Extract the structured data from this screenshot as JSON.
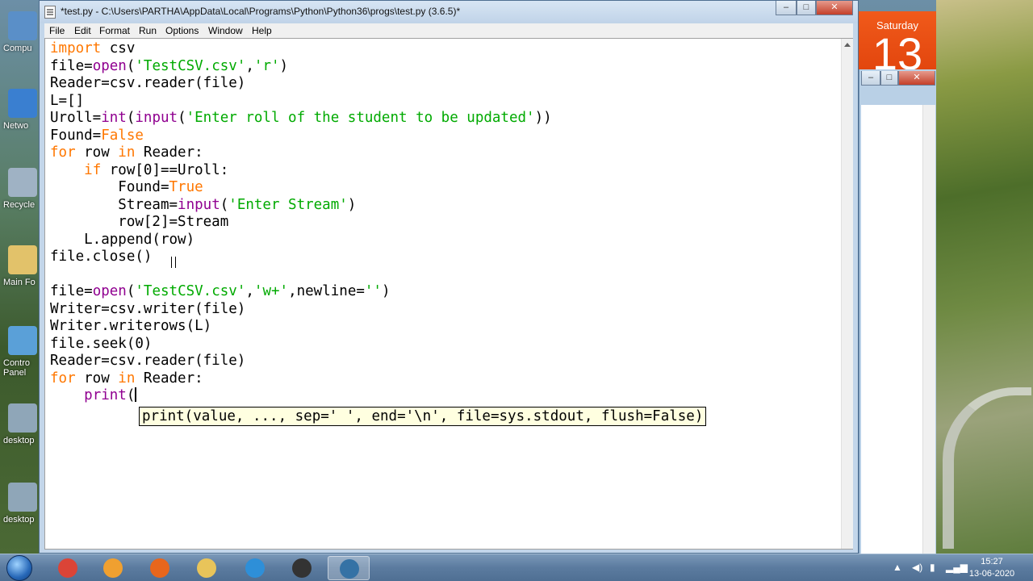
{
  "window": {
    "title": "*test.py - C:\\Users\\PARTHA\\AppData\\Local\\Programs\\Python\\Python36\\progs\\test.py (3.6.5)*",
    "controls": {
      "minimize": "–",
      "maximize": "□",
      "close": "✕"
    }
  },
  "menu": [
    "File",
    "Edit",
    "Format",
    "Run",
    "Options",
    "Window",
    "Help"
  ],
  "code_lines": [
    [
      {
        "t": "import",
        "c": "kw"
      },
      {
        "t": " csv",
        "c": ""
      }
    ],
    [
      {
        "t": "file=",
        "c": ""
      },
      {
        "t": "open",
        "c": "bi"
      },
      {
        "t": "(",
        "c": ""
      },
      {
        "t": "'TestCSV.csv'",
        "c": "str"
      },
      {
        "t": ",",
        "c": ""
      },
      {
        "t": "'r'",
        "c": "str"
      },
      {
        "t": ")",
        "c": ""
      }
    ],
    [
      {
        "t": "Reader=csv.reader(file)",
        "c": ""
      }
    ],
    [
      {
        "t": "L=[]",
        "c": ""
      }
    ],
    [
      {
        "t": "Uroll=",
        "c": ""
      },
      {
        "t": "int",
        "c": "bi"
      },
      {
        "t": "(",
        "c": ""
      },
      {
        "t": "input",
        "c": "bi"
      },
      {
        "t": "(",
        "c": ""
      },
      {
        "t": "'Enter roll of the student to be updated'",
        "c": "str"
      },
      {
        "t": "))",
        "c": ""
      }
    ],
    [
      {
        "t": "Found=",
        "c": ""
      },
      {
        "t": "False",
        "c": "kw"
      }
    ],
    [
      {
        "t": "for",
        "c": "kw"
      },
      {
        "t": " row ",
        "c": ""
      },
      {
        "t": "in",
        "c": "kw"
      },
      {
        "t": " Reader:",
        "c": ""
      }
    ],
    [
      {
        "t": "    ",
        "c": ""
      },
      {
        "t": "if",
        "c": "kw"
      },
      {
        "t": " row[0]==Uroll:",
        "c": ""
      }
    ],
    [
      {
        "t": "        Found=",
        "c": ""
      },
      {
        "t": "True",
        "c": "kw"
      }
    ],
    [
      {
        "t": "        Stream=",
        "c": ""
      },
      {
        "t": "input",
        "c": "bi"
      },
      {
        "t": "(",
        "c": ""
      },
      {
        "t": "'Enter Stream'",
        "c": "str"
      },
      {
        "t": ")",
        "c": ""
      }
    ],
    [
      {
        "t": "        row[2]=Stream",
        "c": ""
      }
    ],
    [
      {
        "t": "    L.append(row)",
        "c": ""
      }
    ],
    [
      {
        "t": "file.close()",
        "c": ""
      }
    ],
    [],
    [
      {
        "t": "file=",
        "c": ""
      },
      {
        "t": "open",
        "c": "bi"
      },
      {
        "t": "(",
        "c": ""
      },
      {
        "t": "'TestCSV.csv'",
        "c": "str"
      },
      {
        "t": ",",
        "c": ""
      },
      {
        "t": "'w+'",
        "c": "str"
      },
      {
        "t": ",newline=",
        "c": ""
      },
      {
        "t": "''",
        "c": "str"
      },
      {
        "t": ")",
        "c": ""
      }
    ],
    [
      {
        "t": "Writer=csv.writer(file)",
        "c": ""
      }
    ],
    [
      {
        "t": "Writer.writerows(L)",
        "c": ""
      }
    ],
    [
      {
        "t": "file.seek(0)",
        "c": ""
      }
    ],
    [
      {
        "t": "Reader=csv.reader(file)",
        "c": ""
      }
    ],
    [
      {
        "t": "for",
        "c": "kw"
      },
      {
        "t": " row ",
        "c": ""
      },
      {
        "t": "in",
        "c": "kw"
      },
      {
        "t": " Reader:",
        "c": ""
      }
    ],
    [
      {
        "t": "    ",
        "c": ""
      },
      {
        "t": "print",
        "c": "bi"
      },
      {
        "t": "(",
        "c": ""
      }
    ]
  ],
  "calltip": "print(value, ..., sep=' ', end='\\n', file=sys.stdout, flush=False)",
  "syntax_colors": {
    "keyword": "#ff7700",
    "builtin": "#900090",
    "string": "#00aa00"
  },
  "desktop_icons": [
    {
      "label": "Compu",
      "icon": "computer-icon"
    },
    {
      "label": "Netwo",
      "icon": "network-icon"
    },
    {
      "label": "Recycle",
      "icon": "recycle-bin-icon"
    },
    {
      "label": "Main Fo",
      "icon": "folder-icon"
    },
    {
      "label": "Contro\nPanel",
      "icon": "control-panel-icon"
    },
    {
      "label": "desktop",
      "icon": "desktop-shortcut-icon"
    },
    {
      "label": "desktop",
      "icon": "desktop-shortcut-icon"
    }
  ],
  "calendar": {
    "day": "Saturday",
    "date": "13"
  },
  "taskbar": {
    "apps": [
      {
        "name": "chrome",
        "icon": "chrome-icon",
        "color": "#db4437"
      },
      {
        "name": "media-player",
        "icon": "media-player-icon",
        "color": "#f0a030"
      },
      {
        "name": "firefox",
        "icon": "firefox-icon",
        "color": "#e8661c"
      },
      {
        "name": "explorer",
        "icon": "folder-icon",
        "color": "#e8c45a"
      },
      {
        "name": "ie",
        "icon": "internet-explorer-icon",
        "color": "#2e8fd8"
      },
      {
        "name": "media-player-classic",
        "icon": "clapperboard-icon",
        "color": "#333333"
      },
      {
        "name": "python-idle",
        "icon": "python-icon",
        "color": "#3572a5"
      }
    ],
    "time": "15:27",
    "date": "13-06-2020"
  }
}
